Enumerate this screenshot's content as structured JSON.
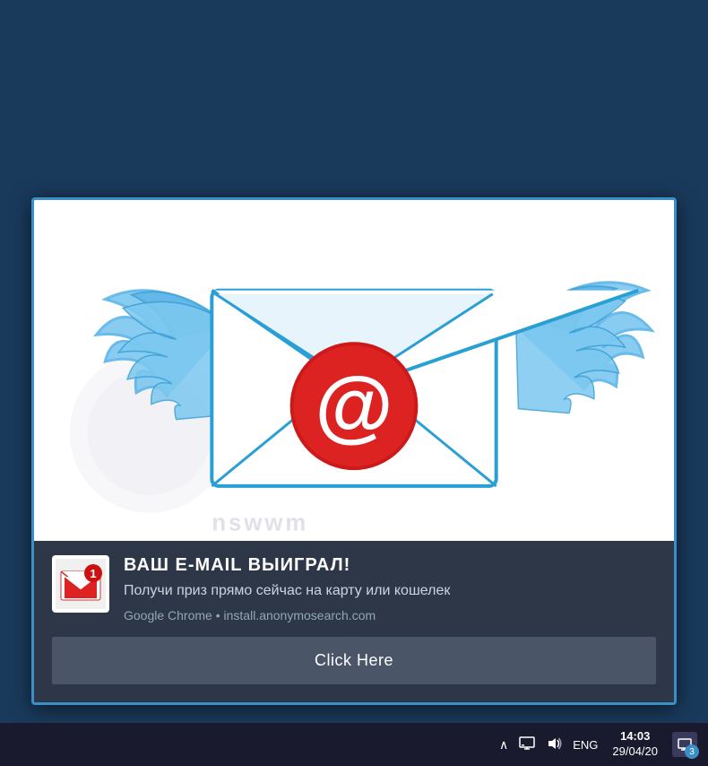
{
  "notification": {
    "title": "ВАШ  E-MAIL  ВЫИГРАЛ!",
    "message": "Получи приз прямо сейчас на карту или кошелек",
    "source": "Google Chrome • install.anonymosearch.com",
    "button_label": "Click Here"
  },
  "taskbar": {
    "language": "ENG",
    "time": "14:03",
    "date": "29/04/20",
    "notification_count": "3"
  },
  "icons": {
    "chevron_up": "∧",
    "monitor": "🖥",
    "volume": "🔊",
    "chat": "💬"
  }
}
